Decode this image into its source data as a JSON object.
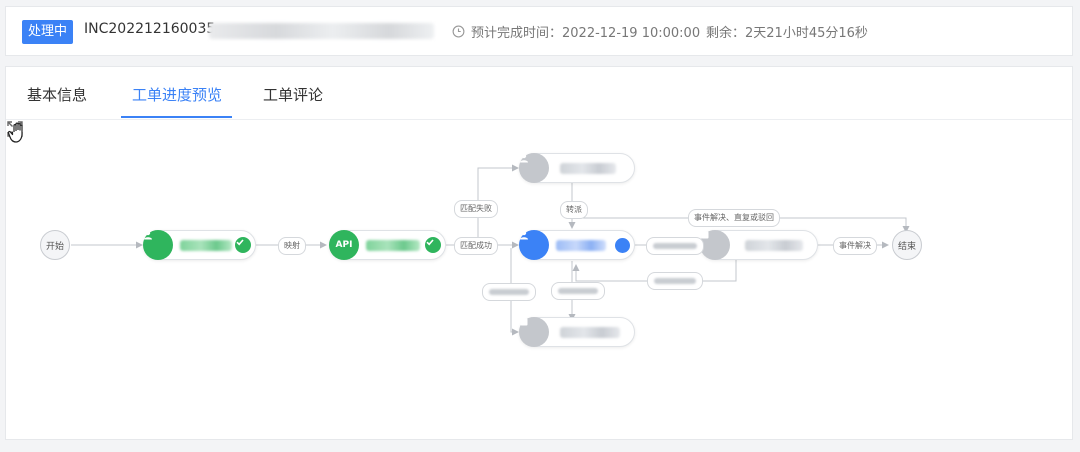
{
  "header": {
    "status": "处理中",
    "ticket_id": "INC202212160035",
    "due_label": "预计完成时间：",
    "due_value": "2022-12-19 10:00:00",
    "remain_label": "剩余：",
    "remain_value": "2天21小时45分16秒"
  },
  "tabs": [
    {
      "label": "基本信息",
      "active": false
    },
    {
      "label": "工单进度预览",
      "active": true
    },
    {
      "label": "工单评论",
      "active": false
    }
  ],
  "flow": {
    "start_label": "开始",
    "end_label": "结束",
    "api_badge": "API",
    "edges": {
      "map": "映射",
      "match_success": "匹配成功",
      "match_fail": "匹配失败",
      "transfer": "转派",
      "event_resolve_reply": "事件解决、直复或驳回",
      "event_resolve": "事件解决"
    }
  },
  "colors": {
    "accent": "#3b82f6",
    "success": "#2fb55d",
    "pending": "#c4c7cc"
  }
}
